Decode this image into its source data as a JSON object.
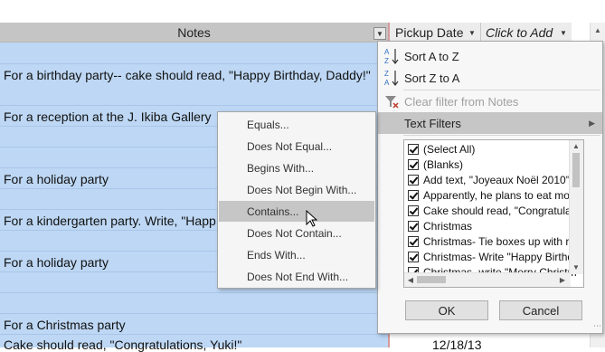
{
  "grid": {
    "columns": [
      {
        "label": "Notes"
      },
      {
        "label": "Pickup Date"
      },
      {
        "label": "Click to Add"
      }
    ],
    "rows": [
      {
        "text": "For a birthday party-- cake should read, \"Happy Birthday, Daddy!\""
      },
      {
        "text": "For a reception at the J. Ikiba Gallery"
      },
      {
        "text": "For a holiday party"
      },
      {
        "text": "For a kindergarten party. Write, \"Happ"
      },
      {
        "text": "For a holiday party"
      },
      {
        "text": "For a Christmas party"
      },
      {
        "text": "Cake should read, \"Congratulations, Yuki!\""
      }
    ],
    "last_date": "12/18/13"
  },
  "filter_menu": {
    "sort_az": "Sort A to Z",
    "sort_za": "Sort Z to A",
    "clear_filter": "Clear filter from Notes",
    "text_filters": "Text Filters",
    "ok": "OK",
    "cancel": "Cancel",
    "list": [
      {
        "label": "(Select All)"
      },
      {
        "label": "(Blanks)"
      },
      {
        "label": "Add text, \"Joyeaux Noël 2010\""
      },
      {
        "label": "Apparently, he plans to eat mo"
      },
      {
        "label": "Cake should read, \"Congratula"
      },
      {
        "label": "Christmas"
      },
      {
        "label": "Christmas- Tie boxes up with ril"
      },
      {
        "label": "Christmas- Write \"Happy Birthd"
      },
      {
        "label": "Christmas- write \"Merry Christm"
      }
    ]
  },
  "text_filters_menu": {
    "items": [
      {
        "label": "Equals..."
      },
      {
        "label": "Does Not Equal..."
      },
      {
        "label": "Begins With..."
      },
      {
        "label": "Does Not Begin With..."
      },
      {
        "label": "Contains..."
      },
      {
        "label": "Does Not Contain..."
      },
      {
        "label": "Ends With..."
      },
      {
        "label": "Does Not End With..."
      }
    ]
  },
  "colors": {
    "selected_row": "#bdd7f4",
    "highlight": "#c6c6c6",
    "accent_blue": "#2e6fbf"
  }
}
